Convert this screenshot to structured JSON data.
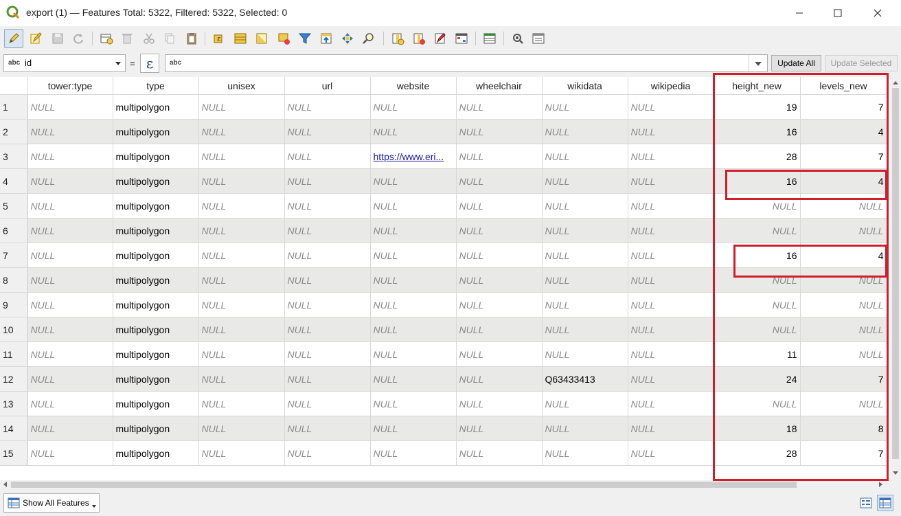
{
  "window": {
    "title": "export (1) — Features Total: 5322, Filtered: 5322, Selected: 0",
    "controls": [
      "minimize-icon",
      "maximize-icon",
      "close-icon"
    ]
  },
  "toolbar": {
    "buttons": [
      {
        "name": "toggle-editing-icon",
        "label": "Toggle editing mode"
      },
      {
        "name": "multi-edit-icon",
        "label": "Toggle multi edit mode"
      },
      {
        "name": "save-edits-icon",
        "label": "Save edits"
      },
      {
        "name": "reload-table-icon",
        "label": "Reload the table"
      },
      {
        "name": "add-feature-icon",
        "label": "Add feature"
      },
      {
        "name": "delete-feature-icon",
        "label": "Delete selected features"
      },
      {
        "name": "cut-icon",
        "label": "Cut selected rows"
      },
      {
        "name": "copy-icon",
        "label": "Copy selected rows"
      },
      {
        "name": "paste-icon",
        "label": "Paste features"
      },
      {
        "name": "select-expression-icon",
        "label": "Select features using an expression"
      },
      {
        "name": "select-all-icon",
        "label": "Select all"
      },
      {
        "name": "invert-selection-icon",
        "label": "Invert selection"
      },
      {
        "name": "deselect-all-icon",
        "label": "Deselect all"
      },
      {
        "name": "filter-icon",
        "label": "Filter/Select features using form"
      },
      {
        "name": "move-selection-top-icon",
        "label": "Move selection to top"
      },
      {
        "name": "pan-to-selection-icon",
        "label": "Pan map to selected rows"
      },
      {
        "name": "zoom-to-selection-icon",
        "label": "Zoom map to selected rows"
      },
      {
        "name": "new-field-icon",
        "label": "New field"
      },
      {
        "name": "delete-field-icon",
        "label": "Delete field"
      },
      {
        "name": "field-calculator-icon",
        "label": "Open field calculator"
      },
      {
        "name": "conditional-formatting-icon",
        "label": "Conditional formatting"
      },
      {
        "name": "dock-icon",
        "label": "Dock attribute table"
      },
      {
        "name": "actions-icon",
        "label": "Actions"
      },
      {
        "name": "form-view-icon",
        "label": "Form view"
      }
    ]
  },
  "expression_bar": {
    "field_type": "abc",
    "field_value": "id",
    "equals": "=",
    "epsilon": "ε",
    "expression_type": "abc",
    "expression_value": "",
    "update_all": "Update All",
    "update_selected": "Update Selected"
  },
  "table": {
    "columns": [
      "tower:type",
      "type",
      "unisex",
      "url",
      "website",
      "wheelchair",
      "wikidata",
      "wikipedia",
      "height_new",
      "levels_new"
    ],
    "rows": [
      {
        "n": "1",
        "cells": [
          "NULL",
          "multipolygon",
          "NULL",
          "NULL",
          "NULL",
          "NULL",
          "NULL",
          "NULL",
          "19",
          "7"
        ]
      },
      {
        "n": "2",
        "cells": [
          "NULL",
          "multipolygon",
          "NULL",
          "NULL",
          "NULL",
          "NULL",
          "NULL",
          "NULL",
          "16",
          "4"
        ]
      },
      {
        "n": "3",
        "cells": [
          "NULL",
          "multipolygon",
          "NULL",
          "NULL",
          "https://www.eri...",
          "NULL",
          "NULL",
          "NULL",
          "28",
          "7"
        ]
      },
      {
        "n": "4",
        "cells": [
          "NULL",
          "multipolygon",
          "NULL",
          "NULL",
          "NULL",
          "NULL",
          "NULL",
          "NULL",
          "16",
          "4"
        ]
      },
      {
        "n": "5",
        "cells": [
          "NULL",
          "multipolygon",
          "NULL",
          "NULL",
          "NULL",
          "NULL",
          "NULL",
          "NULL",
          "NULL",
          "NULL"
        ]
      },
      {
        "n": "6",
        "cells": [
          "NULL",
          "multipolygon",
          "NULL",
          "NULL",
          "NULL",
          "NULL",
          "NULL",
          "NULL",
          "NULL",
          "NULL"
        ]
      },
      {
        "n": "7",
        "cells": [
          "NULL",
          "multipolygon",
          "NULL",
          "NULL",
          "NULL",
          "NULL",
          "NULL",
          "NULL",
          "16",
          "4"
        ]
      },
      {
        "n": "8",
        "cells": [
          "NULL",
          "multipolygon",
          "NULL",
          "NULL",
          "NULL",
          "NULL",
          "NULL",
          "NULL",
          "NULL",
          "NULL"
        ]
      },
      {
        "n": "9",
        "cells": [
          "NULL",
          "multipolygon",
          "NULL",
          "NULL",
          "NULL",
          "NULL",
          "NULL",
          "NULL",
          "NULL",
          "NULL"
        ]
      },
      {
        "n": "10",
        "cells": [
          "NULL",
          "multipolygon",
          "NULL",
          "NULL",
          "NULL",
          "NULL",
          "NULL",
          "NULL",
          "NULL",
          "NULL"
        ]
      },
      {
        "n": "11",
        "cells": [
          "NULL",
          "multipolygon",
          "NULL",
          "NULL",
          "NULL",
          "NULL",
          "NULL",
          "NULL",
          "11",
          "NULL"
        ]
      },
      {
        "n": "12",
        "cells": [
          "NULL",
          "multipolygon",
          "NULL",
          "NULL",
          "NULL",
          "NULL",
          "Q63433413",
          "NULL",
          "24",
          "7"
        ]
      },
      {
        "n": "13",
        "cells": [
          "NULL",
          "multipolygon",
          "NULL",
          "NULL",
          "NULL",
          "NULL",
          "NULL",
          "NULL",
          "NULL",
          "NULL"
        ]
      },
      {
        "n": "14",
        "cells": [
          "NULL",
          "multipolygon",
          "NULL",
          "NULL",
          "NULL",
          "NULL",
          "NULL",
          "NULL",
          "18",
          "8"
        ]
      },
      {
        "n": "15",
        "cells": [
          "NULL",
          "multipolygon",
          "NULL",
          "NULL",
          "NULL",
          "NULL",
          "NULL",
          "NULL",
          "28",
          "7"
        ]
      }
    ]
  },
  "bottom": {
    "show_all_label": "Show All Features",
    "view_buttons": [
      "form-view-icon",
      "table-view-icon"
    ]
  },
  "colors": {
    "highlight": "#d11d2a",
    "null_text": "#8a8a8a",
    "link": "#1a1aa6",
    "alt_row": "#e9e9e7"
  }
}
